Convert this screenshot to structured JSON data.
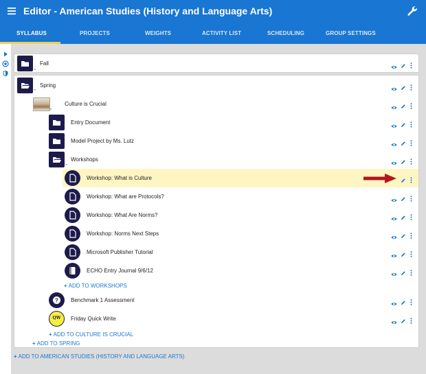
{
  "app": {
    "title": "Editor - American Studies (History and Language Arts)"
  },
  "tabs": [
    {
      "label": "SYLLABUS",
      "active": true
    },
    {
      "label": "PROJECTS"
    },
    {
      "label": "WEIGHTS"
    },
    {
      "label": "ACTIVITY LIST"
    },
    {
      "label": "SCHEDULING"
    },
    {
      "label": "GROUP SETTINGS"
    }
  ],
  "colors": {
    "header": "#1976d2",
    "tab_indicator": "#f2d04f",
    "avatar": "#1d1b4b",
    "highlight": "#fdf6c3",
    "link": "#1976d2",
    "arrow": "#b3161c"
  },
  "left_rail": [
    "play-icon",
    "target-icon",
    "shield-icon"
  ],
  "syllabus": {
    "fall": {
      "label": "Fall",
      "icon": "folder-icon"
    },
    "spring": {
      "label": "Spring",
      "icon": "folder-open-icon",
      "project": {
        "label": "Culture is Crucial",
        "icon": "project-thumbnail",
        "items": [
          {
            "label": "Entry Document",
            "icon": "folder-icon"
          },
          {
            "label": "Model Project by Ms. Lutz",
            "icon": "folder-icon"
          },
          {
            "label": "Workshops",
            "icon": "folder-open-icon"
          }
        ],
        "workshops": [
          {
            "label": "Workshop: What is Culture",
            "icon": "document-icon",
            "highlighted": true
          },
          {
            "label": "Workshop: What are Protocols?",
            "icon": "document-icon"
          },
          {
            "label": "Workshop: What Are Norms?",
            "icon": "document-icon"
          },
          {
            "label": "Workshop: Norms Next Steps",
            "icon": "document-icon"
          },
          {
            "label": "Microsoft Publisher Tutorial",
            "icon": "document-icon"
          },
          {
            "label": "ECHO Entry Journal 9/6/12",
            "icon": "journal-icon"
          }
        ],
        "add_workshops": "ADD TO WORKSHOPS",
        "after": [
          {
            "label": "Benchmark 1 Assessment",
            "icon": "question-icon"
          },
          {
            "label": "Friday Quick Write",
            "icon": "quickwrite-badge",
            "badge": "QW"
          }
        ],
        "add_project": "ADD TO CULTURE IS CRUCIAL"
      },
      "add_spring": "ADD TO SPRING"
    },
    "add_course": "ADD TO AMERICAN STUDIES (HISTORY AND LANGUAGE ARTS)"
  }
}
